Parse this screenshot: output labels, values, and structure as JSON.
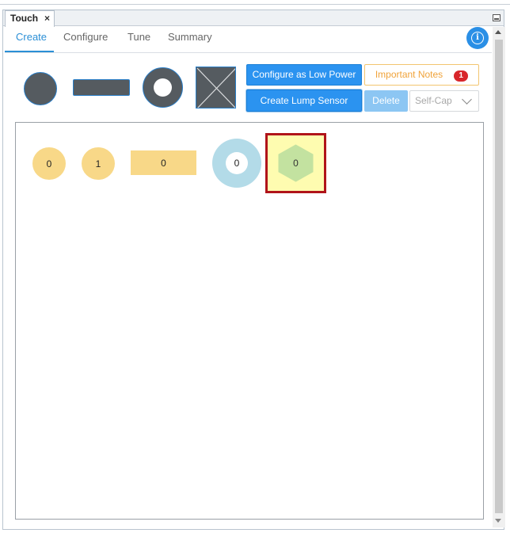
{
  "window": {
    "doc_tab_label": "Touch",
    "doc_tab_close": "×"
  },
  "tabs": [
    {
      "label": "Create",
      "active": true
    },
    {
      "label": "Configure",
      "active": false
    },
    {
      "label": "Tune",
      "active": false
    },
    {
      "label": "Summary",
      "active": false
    }
  ],
  "info_icon": "i",
  "toolbar": {
    "shapes": [
      "button-sensor-icon",
      "slider-sensor-icon",
      "wheel-sensor-icon",
      "surface-sensor-icon"
    ],
    "low_power_label": "Configure as Low Power",
    "lump_label": "Create Lump Sensor",
    "notes_label": "Important Notes",
    "notes_count": "1",
    "delete_label": "Delete",
    "sensing_mode": "Self-Cap"
  },
  "canvas": {
    "sensors": [
      {
        "type": "button",
        "value": "0"
      },
      {
        "type": "button",
        "value": "1"
      },
      {
        "type": "slider",
        "value": "0"
      },
      {
        "type": "wheel",
        "value": "0"
      },
      {
        "type": "lump",
        "value": "0",
        "selected": true
      }
    ]
  },
  "colors": {
    "accent": "#2b93f0",
    "sensor_fill": "#f8d888",
    "wheel_fill": "#b3dbe8",
    "lump_fill": "#fefcb0",
    "hex_fill": "#c3e2a0",
    "selection_border": "#b0141a",
    "badge": "#d8262b"
  }
}
